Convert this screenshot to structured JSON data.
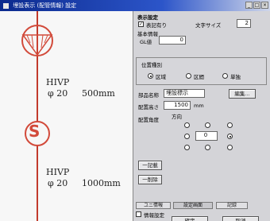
{
  "window": {
    "title": "埋設表示 (配管情報) 設定",
    "buttons": {
      "minimize": "_",
      "maximize": "□",
      "close": "×"
    }
  },
  "drawing": {
    "labels": [
      {
        "text": "HIVP"
      },
      {
        "text": "φ 20"
      },
      {
        "text": "500mm"
      },
      {
        "text": "HIVP"
      },
      {
        "text": "φ 20"
      },
      {
        "text": "1000mm"
      }
    ],
    "marker_letter": "S",
    "colors": {
      "line": "#c23a2c",
      "marker": "#d24a3a"
    }
  },
  "panel": {
    "section_title": "表示設定",
    "show_label": "表記有り",
    "show_checked": true,
    "font_size_label": "文字サイズ",
    "font_size_value": "2",
    "basic_info_label": "基本情報",
    "gl_label": "GL値",
    "gl_value": "0",
    "type_group_title": "位置種別",
    "type_options": [
      "区域",
      "区間",
      "単独"
    ],
    "type_selected": 0,
    "material_label": "部品名称",
    "material_value": "埋設標示",
    "material_button": "編集...",
    "height_label": "配置高さ",
    "height_value": "1500",
    "height_unit": "mm",
    "angle_label": "配置角度",
    "direction_label": "方向",
    "direction_center_value": "0",
    "add_button": "一記載",
    "remove_button": "一削除",
    "tabs": [
      "ユニ情報",
      "設定画面",
      "記録"
    ],
    "info_check_label": "情報設定",
    "ok_button": "確定",
    "cancel_button": "取消"
  }
}
